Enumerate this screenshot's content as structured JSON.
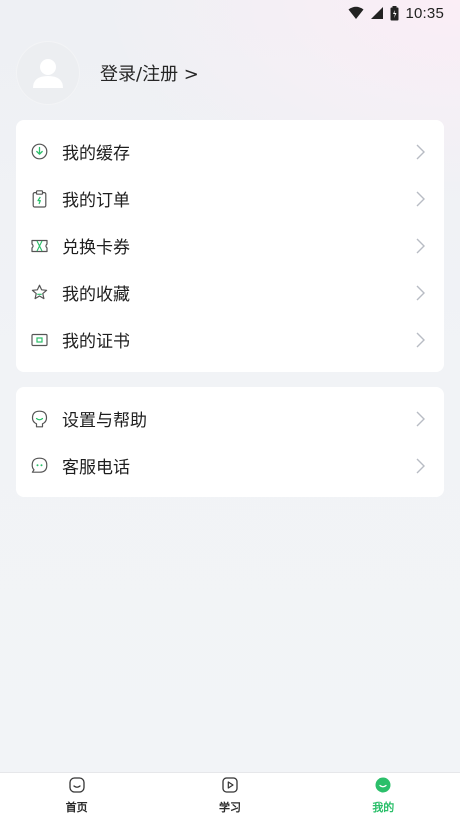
{
  "status_bar": {
    "time": "10:35",
    "icons": [
      "wifi-icon",
      "signal-icon",
      "battery-icon"
    ]
  },
  "profile": {
    "login_label": "登录/注册 >",
    "avatar_icon": "user-avatar-icon"
  },
  "menu_group_1": {
    "items": [
      {
        "label": "我的缓存",
        "icon": "download-circle-icon"
      },
      {
        "label": "我的订单",
        "icon": "clipboard-icon"
      },
      {
        "label": "兑换卡券",
        "icon": "ticket-icon"
      },
      {
        "label": "我的收藏",
        "icon": "star-icon"
      },
      {
        "label": "我的证书",
        "icon": "certificate-icon"
      }
    ]
  },
  "menu_group_2": {
    "items": [
      {
        "label": "设置与帮助",
        "icon": "settings-help-icon"
      },
      {
        "label": "客服电话",
        "icon": "chat-bubble-icon"
      }
    ]
  },
  "bottom_nav": {
    "items": [
      {
        "label": "首页",
        "icon": "home-face-icon",
        "active": false
      },
      {
        "label": "学习",
        "icon": "play-square-icon",
        "active": false
      },
      {
        "label": "我的",
        "icon": "profile-face-icon",
        "active": true
      }
    ]
  },
  "colors": {
    "accent_green": "#2bbf6a",
    "icon_stroke": "#4a4a4a",
    "chevron": "#b8bcc4",
    "card_bg": "#ffffff"
  }
}
